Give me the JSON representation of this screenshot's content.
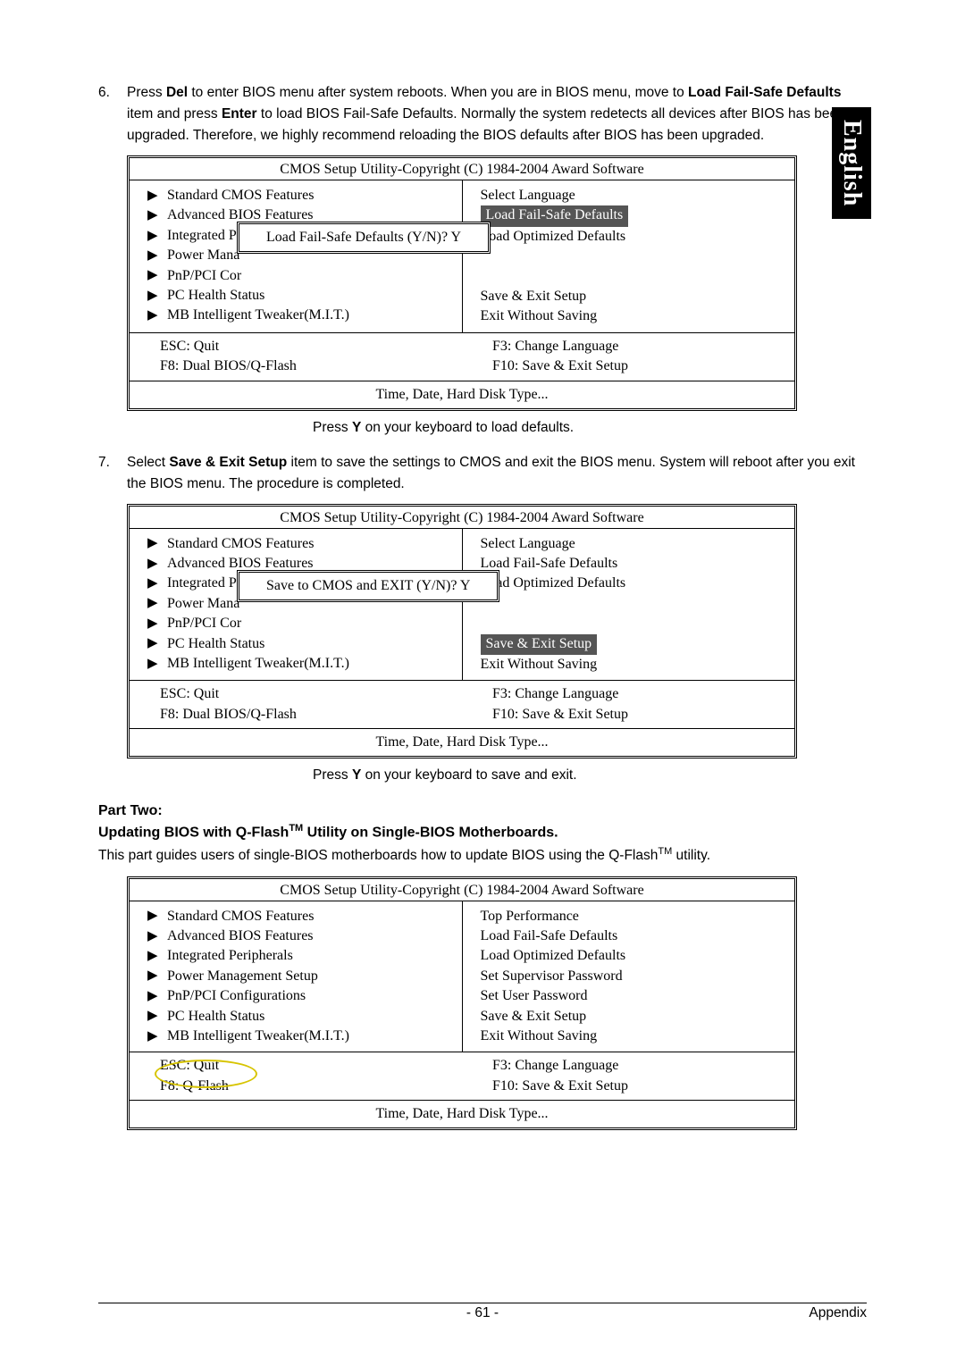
{
  "sideTab": "English",
  "step6": {
    "num": "6.",
    "segments": [
      "Press ",
      "Del",
      " to enter BIOS menu after system reboots. When you are in BIOS menu, move to ",
      "Load Fail-Safe Defaults",
      " item and press ",
      "Enter",
      " to load BIOS Fail-Safe Defaults. Normally the system redetects all devices after BIOS has been upgraded. Therefore, we highly recommend reloading the BIOS defaults after BIOS has been upgraded."
    ]
  },
  "bios1": {
    "title": "CMOS Setup Utility-Copyright (C) 1984-2004 Award Software",
    "left": [
      "Standard CMOS Features",
      "Advanced BIOS Features",
      "Integrated Peripherals",
      "Power Mana",
      "PnP/PCI Cor",
      "PC Health Status",
      "MB Intelligent Tweaker(M.I.T.)"
    ],
    "right": [
      "Select Language",
      "Load Fail-Safe Defaults",
      "Load Optimized Defaults",
      "",
      "",
      "Save & Exit Setup",
      "Exit Without Saving"
    ],
    "rightHighlightIndex": 1,
    "dialog": "Load Fail-Safe Defaults (Y/N)? Y",
    "foot": {
      "l1": "ESC: Quit",
      "l2": "F8: Dual BIOS/Q-Flash",
      "r1": "F3: Change Language",
      "r2": "F10: Save & Exit Setup"
    },
    "hint": "Time, Date, Hard Disk Type..."
  },
  "after1": {
    "pre": "Press ",
    "bold": "Y",
    "post": " on your keyboard to load defaults."
  },
  "step7": {
    "num": "7.",
    "segments": [
      "Select ",
      "Save & Exit Setup",
      " item to save the settings to CMOS and exit the BIOS menu. System will reboot after you exit the BIOS menu. The procedure is completed."
    ]
  },
  "bios2": {
    "title": "CMOS Setup Utility-Copyright (C) 1984-2004 Award Software",
    "left": [
      "Standard CMOS Features",
      "Advanced BIOS Features",
      "Integrated Peripherals",
      "Power Mana",
      "PnP/PCI Cor",
      "PC Health Status",
      "MB Intelligent Tweaker(M.I.T.)"
    ],
    "right": [
      "Select Language",
      "Load Fail-Safe Defaults",
      "Load Optimized Defaults",
      "",
      "",
      "Save & Exit Setup",
      "Exit Without Saving"
    ],
    "rightHighlightIndex": 5,
    "dialog": "Save to CMOS and EXIT (Y/N)? Y",
    "foot": {
      "l1": "ESC: Quit",
      "l2": "F8: Dual BIOS/Q-Flash",
      "r1": "F3: Change Language",
      "r2": "F10: Save & Exit Setup"
    },
    "hint": "Time, Date, Hard Disk Type..."
  },
  "after2": {
    "pre": "Press ",
    "bold": "Y",
    "post": " on your keyboard to save and exit."
  },
  "partTwoHeading": "Part Two:",
  "partTwoSub": {
    "pre": "Updating BIOS with Q-Flash",
    "tm": "TM",
    "post": " Utility on Single-BIOS Motherboards."
  },
  "partTwoPara": {
    "pre": "This part guides users of single-BIOS motherboards how to update BIOS using the Q-Flash",
    "tm": "TM",
    "post": " utility."
  },
  "bios3": {
    "title": "CMOS Setup Utility-Copyright (C) 1984-2004 Award Software",
    "left": [
      "Standard CMOS Features",
      "Advanced BIOS Features",
      "Integrated Peripherals",
      "Power Management Setup",
      "PnP/PCI Configurations",
      "PC Health Status",
      "MB Intelligent Tweaker(M.I.T.)"
    ],
    "right": [
      "Top Performance",
      "Load Fail-Safe Defaults",
      "Load Optimized Defaults",
      "Set Supervisor Password",
      "Set User Password",
      "Save & Exit Setup",
      "Exit Without Saving"
    ],
    "foot": {
      "l1": "ESC: Quit",
      "l2": "F8: Q-Flash",
      "r1": "F3: Change Language",
      "r2": "F10: Save & Exit Setup"
    },
    "hint": "Time, Date, Hard Disk Type..."
  },
  "footer": {
    "page": "- 61 -",
    "section": "Appendix"
  }
}
